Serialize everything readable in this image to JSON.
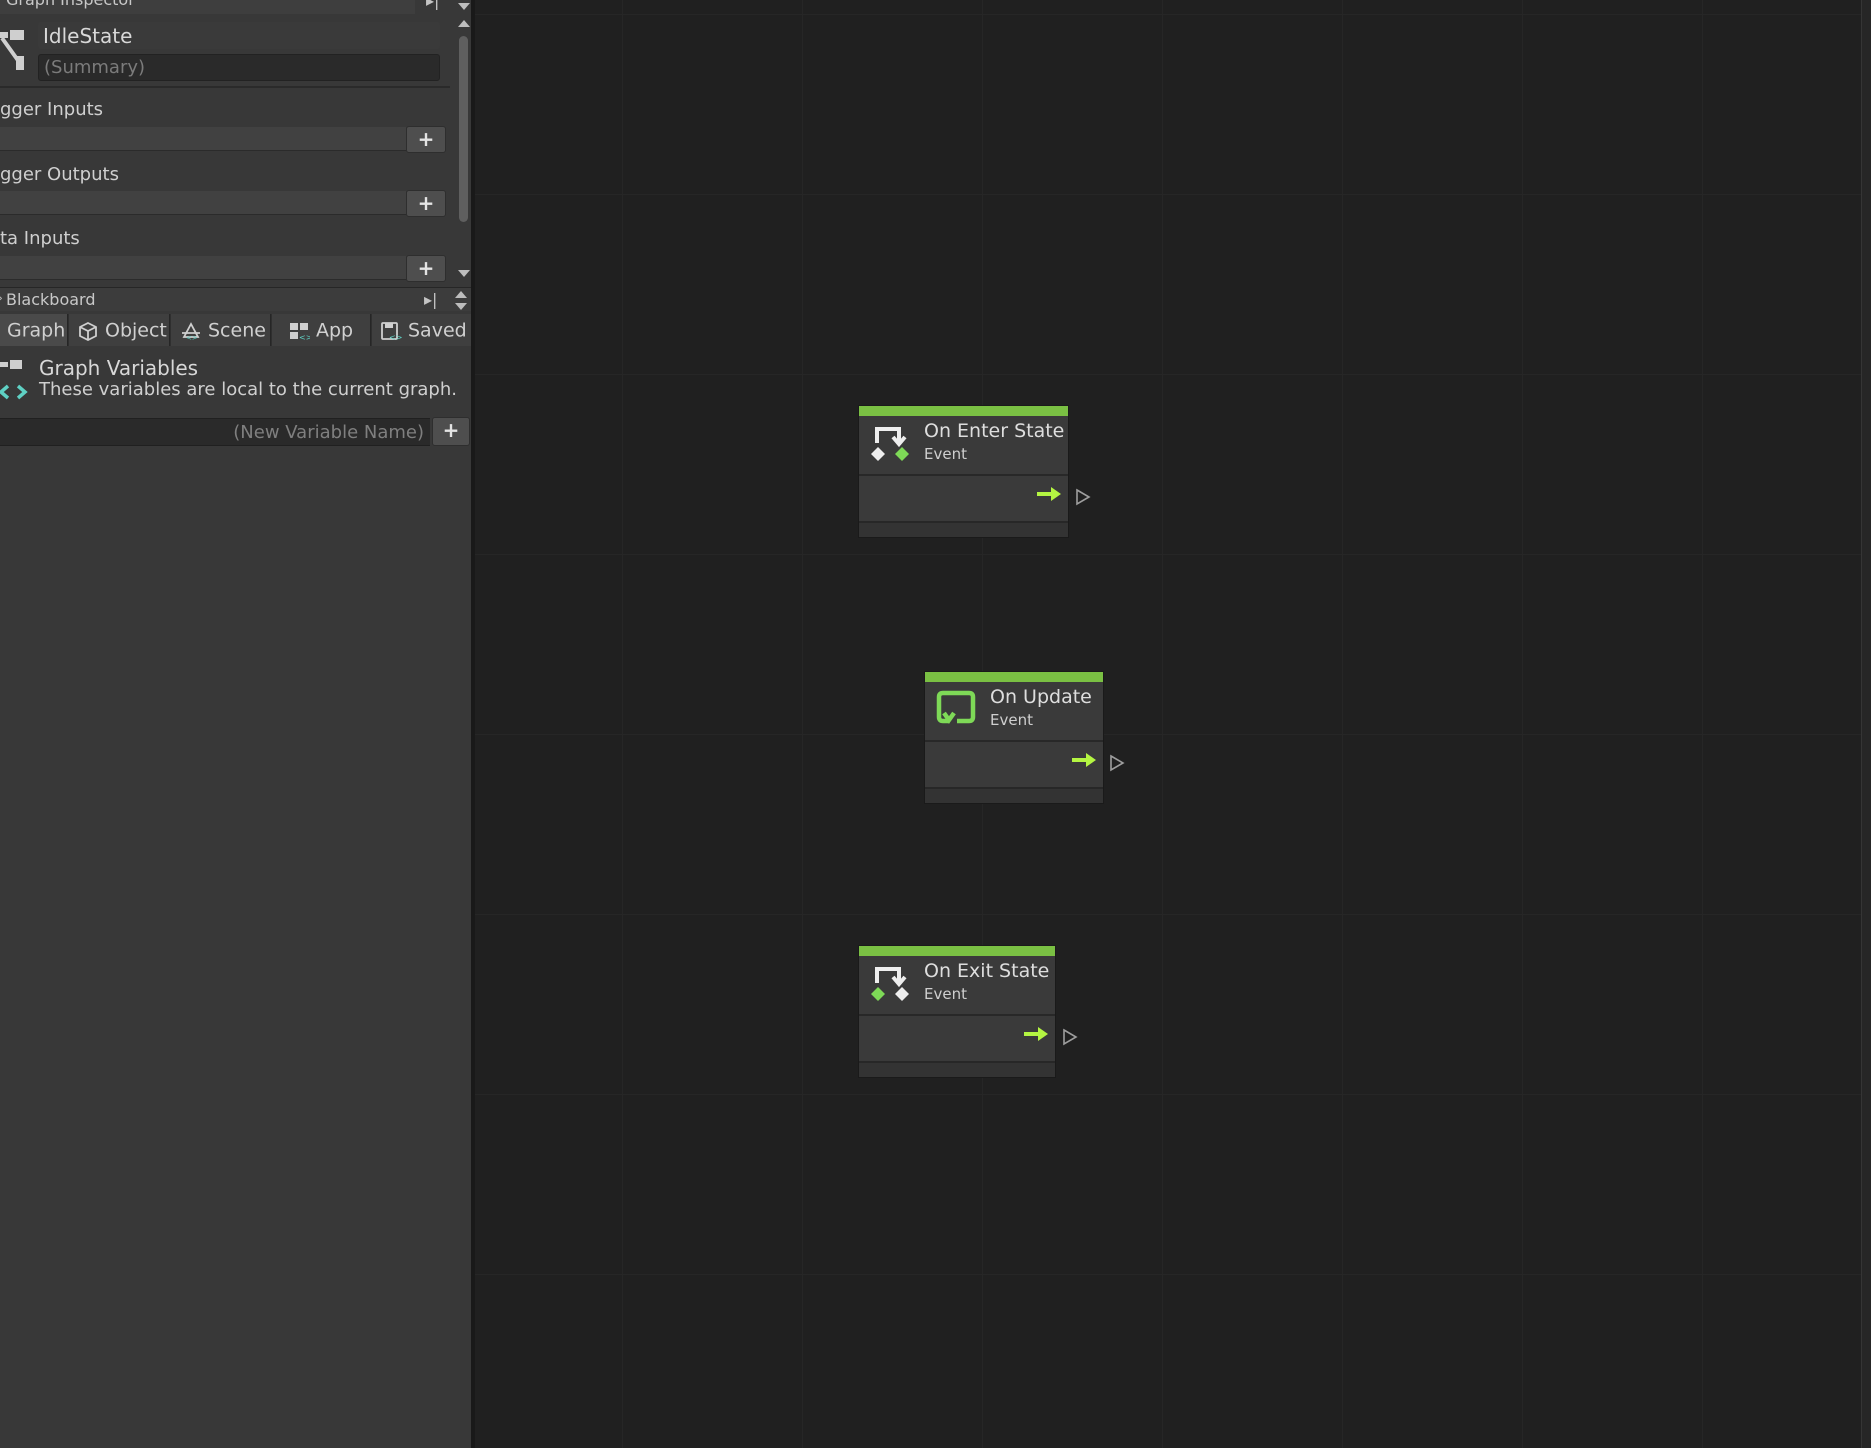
{
  "inspector": {
    "header_title": "Graph Inspector",
    "graph_name": "IdleState",
    "summary_placeholder": "(Summary)",
    "sections": [
      {
        "title": "gger Inputs",
        "add_label": "+"
      },
      {
        "title": "gger Outputs",
        "add_label": "+"
      },
      {
        "title": "ta Inputs",
        "add_label": "+"
      }
    ]
  },
  "blackboard": {
    "header_title": "Blackboard",
    "tabs": [
      {
        "label": "Graph",
        "icon": "graph-icon"
      },
      {
        "label": "Object",
        "icon": "cube-icon"
      },
      {
        "label": "Scene",
        "icon": "scene-icon"
      },
      {
        "label": "App",
        "icon": "app-icon"
      },
      {
        "label": "Saved",
        "icon": "saved-icon"
      }
    ],
    "active_tab": "Graph",
    "variables_title": "Graph Variables",
    "variables_description": "These variables are local to the current graph.",
    "new_variable_placeholder": "(New Variable Name)",
    "add_label": "+"
  },
  "nodes": [
    {
      "title": "On Enter State",
      "subtitle": "Event",
      "icon": "state-enter-icon"
    },
    {
      "title": "On Update",
      "subtitle": "Event",
      "icon": "update-loop-icon"
    },
    {
      "title": "On Exit State",
      "subtitle": "Event",
      "icon": "state-exit-icon"
    }
  ],
  "colors": {
    "accent_green": "#7ac043",
    "flow_arrow": "#b4f542",
    "panel_bg": "#383838",
    "canvas_bg": "#202020"
  }
}
